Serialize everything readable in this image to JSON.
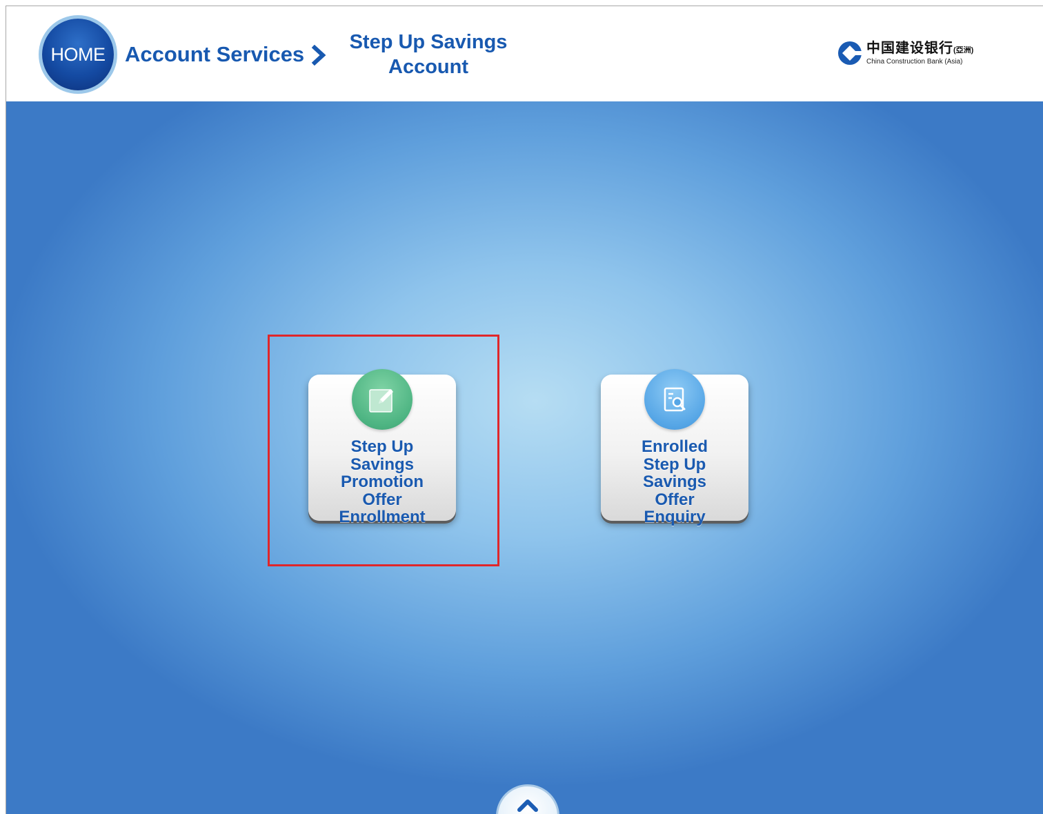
{
  "header": {
    "home_label": "HOME",
    "breadcrumb": {
      "parent": "Account Services",
      "current": "Step Up Savings\nAccount"
    },
    "logo": {
      "chinese_name": "中国建设银行",
      "chinese_suffix": "(亞洲)",
      "english_name": "China Construction Bank (Asia)"
    }
  },
  "main": {
    "tiles": [
      {
        "label": "Step Up\nSavings\nPromotion\nOffer\nEnrollment",
        "icon": "edit-icon",
        "highlighted": true
      },
      {
        "label": "Enrolled\nStep Up\nSavings\nOffer\nEnquiry",
        "icon": "document-search-icon",
        "highlighted": false
      }
    ],
    "scroll_button_icon": "chevron-up-icon"
  },
  "colors": {
    "brand_blue": "#1859b0",
    "home_button": "#144aa2",
    "highlight_border": "#e0262a",
    "enroll_icon": "#4db482",
    "enquiry_icon": "#56a6e6"
  }
}
